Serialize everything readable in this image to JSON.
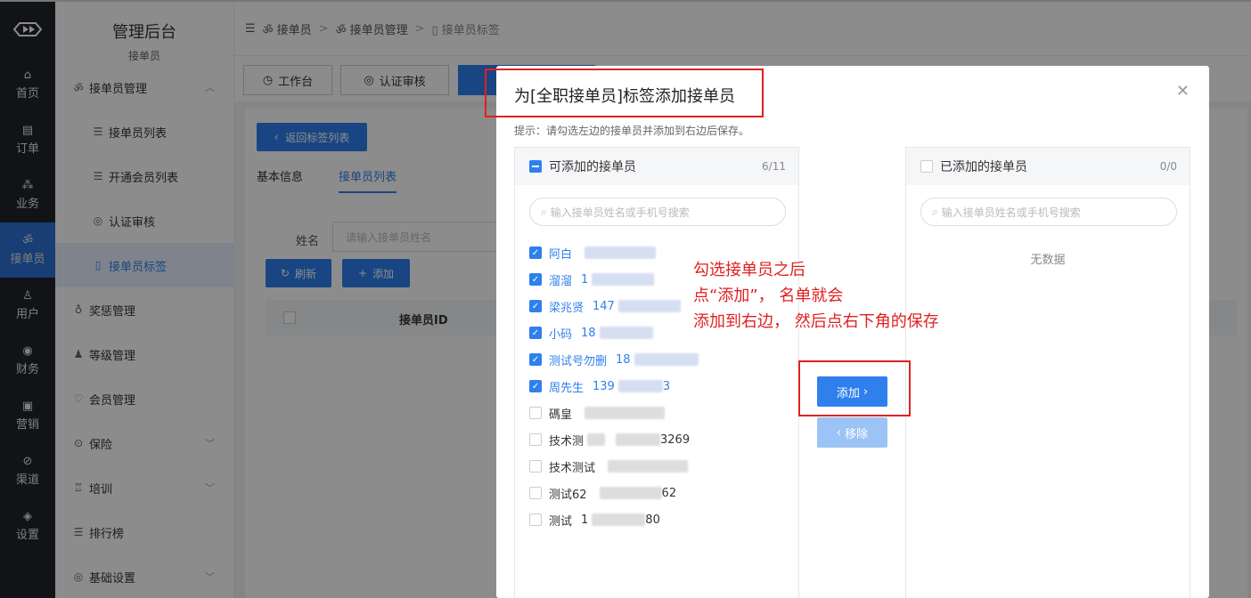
{
  "rail": {
    "items": [
      {
        "label": "首页",
        "icon": "⌂"
      },
      {
        "label": "订单",
        "icon": "▤"
      },
      {
        "label": "业务",
        "icon": "⁂"
      },
      {
        "label": "接单员",
        "icon": "ॐ"
      },
      {
        "label": "用户",
        "icon": "♙"
      },
      {
        "label": "财务",
        "icon": "◉"
      },
      {
        "label": "营销",
        "icon": "▣"
      },
      {
        "label": "渠道",
        "icon": "⊘"
      },
      {
        "label": "设置",
        "icon": "◈"
      }
    ]
  },
  "subnav": {
    "title": "管理后台",
    "subtitle": "接单员",
    "items": [
      {
        "label": "接单员管理",
        "icon": "ॐ"
      },
      {
        "label": "接单员列表",
        "icon": "☰"
      },
      {
        "label": "开通会员列表",
        "icon": "☰"
      },
      {
        "label": "认证审核",
        "icon": "◎"
      },
      {
        "label": "接单员标签",
        "icon": "▯"
      },
      {
        "label": "奖惩管理",
        "icon": "♁"
      },
      {
        "label": "等级管理",
        "icon": "♟"
      },
      {
        "label": "会员管理",
        "icon": "♡"
      },
      {
        "label": "保险",
        "icon": "⊙"
      },
      {
        "label": "培训",
        "icon": "♖"
      },
      {
        "label": "排行榜",
        "icon": "☰"
      },
      {
        "label": "基础设置",
        "icon": "◎"
      }
    ]
  },
  "breadcrumb": {
    "c1": "接单员",
    "c2": "接单员管理",
    "c3": "接单员标签"
  },
  "tabs": {
    "t1": "工作台",
    "t2": "认证审核"
  },
  "content": {
    "back": "返回标签列表",
    "tab_info": "基本信息",
    "tab_list": "接单员列表",
    "name_label": "姓名",
    "name_placeholder": "请输入接单员姓名",
    "refresh": "刷新",
    "add": "添加",
    "col_id": "接单员ID"
  },
  "dialog": {
    "title": "为[全职接单员]标签添加接单员",
    "hint": "提示：请勾选左边的接单员并添加到右边后保存。",
    "left_title": "可添加的接单员",
    "left_count": "6/11",
    "right_title": "已添加的接单员",
    "right_count": "0/0",
    "search_placeholder": "输入接单员姓名或手机号搜索",
    "no_data": "无数据",
    "btn_add": "添加",
    "btn_remove": "移除",
    "annotation_1": "勾选接单员之后",
    "annotation_2": "点“添加”， 名单就会",
    "annotation_3": "添加到右边， 然后点右下角的保存",
    "candidates": [
      {
        "name": "阿白",
        "phone": "",
        "checked": true
      },
      {
        "name": "溜溜",
        "phone": "1",
        "checked": true
      },
      {
        "name": "梁兆贤",
        "phone": "147",
        "checked": true
      },
      {
        "name": "小码",
        "phone": "18",
        "checked": true
      },
      {
        "name": "测试号勿删",
        "phone": "18",
        "checked": true
      },
      {
        "name": "周先生",
        "phone": "139",
        "tail": "3",
        "checked": true
      },
      {
        "name": "碼皇",
        "phone": "",
        "checked": false
      },
      {
        "name": "技术测",
        "phone": "",
        "tail": "3269",
        "checked": false
      },
      {
        "name": "技术测试",
        "phone": "",
        "checked": false
      },
      {
        "name": "测试62",
        "phone": "",
        "tail": "62",
        "checked": false
      },
      {
        "name": "测试",
        "phone": "1",
        "tail": "80",
        "checked": false
      }
    ]
  }
}
